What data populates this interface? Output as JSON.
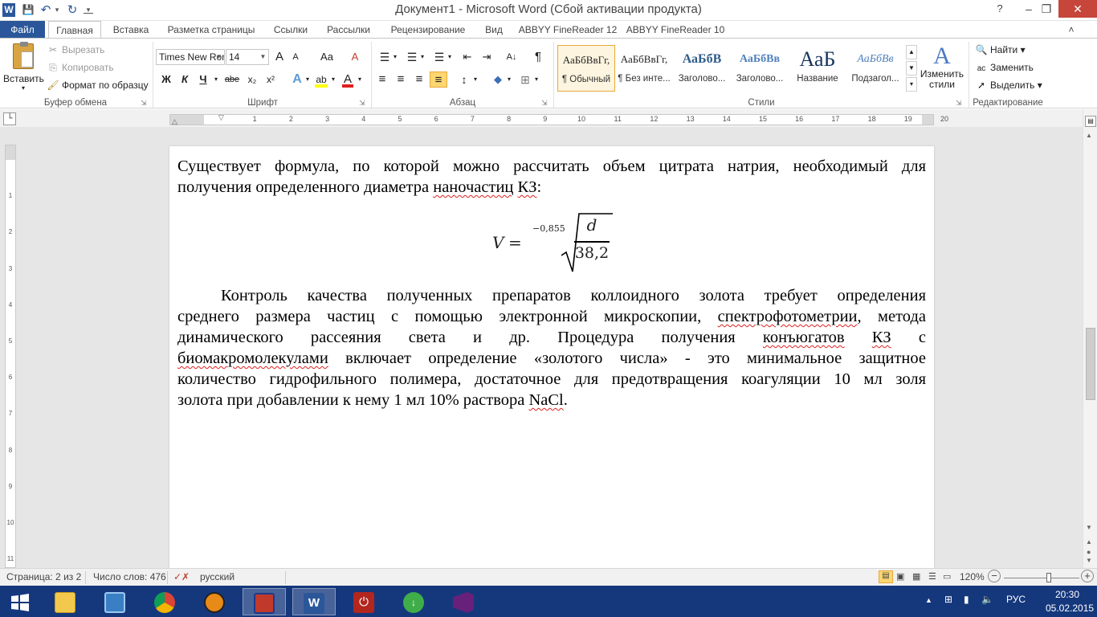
{
  "window": {
    "title": "Документ1 - Microsoft Word (Сбой активации продукта)",
    "help": "?",
    "minimize": "–",
    "restore": "❐",
    "close": "✕"
  },
  "quick_access": {
    "app_icon": "W",
    "save": "💾",
    "undo": "↶",
    "undo_arrow": "▾",
    "repeat": "↻",
    "customize": "▾"
  },
  "tabs": [
    "Файл",
    "Главная",
    "Вставка",
    "Разметка страницы",
    "Ссылки",
    "Рассылки",
    "Рецензирование",
    "Вид",
    "ABBYY FineReader 12",
    "ABBYY FineReader 10"
  ],
  "ribbon_collapse": "˄",
  "clipboard": {
    "group_label": "Буфер обмена",
    "paste": "Вставить",
    "cut": "Вырезать",
    "copy": "Копировать",
    "format_painter": "Формат по образцу"
  },
  "font": {
    "group_label": "Шрифт",
    "family": "Times New Roman",
    "size": "14",
    "grow": "A",
    "shrink": "A",
    "change_case": "Aa",
    "clear": "A",
    "bold": "Ж",
    "italic": "К",
    "underline": "Ч",
    "strike": "abe",
    "subscript": "x₂",
    "superscript": "x²",
    "text_effects": "A",
    "highlight": "ab",
    "font_color": "A",
    "highlight_color": "#ffff00",
    "font_color_value": "#e02020"
  },
  "paragraph": {
    "group_label": "Абзац",
    "bullets": "☰",
    "numbering": "☰",
    "multilevel": "☰",
    "decrease_indent": "⇤",
    "increase_indent": "⇥",
    "sort": "A↓",
    "show_marks": "¶",
    "align_left": "≡",
    "align_center": "≡",
    "align_right": "≡",
    "justify": "≡",
    "line_spacing": "↕",
    "shading": "◆",
    "borders": "⊞"
  },
  "styles": {
    "group_label": "Стили",
    "items": [
      {
        "preview": "АаБбВвГг,",
        "name": "¶ Обычный"
      },
      {
        "preview": "АаБбВвГг,",
        "name": "¶ Без инте..."
      },
      {
        "preview": "АаБбВ",
        "name": "Заголово..."
      },
      {
        "preview": "АаБбВв",
        "name": "Заголово..."
      },
      {
        "preview": "АаБ",
        "name": "Название"
      },
      {
        "preview": "АаБбВв",
        "name": "Подзагол..."
      }
    ],
    "change_styles": "Изменить стили"
  },
  "editing": {
    "group_label": "Редактирование",
    "find": "Найти",
    "replace": "Заменить",
    "select": "Выделить"
  },
  "ruler": {
    "h_ticks": [
      "1",
      "2",
      "3",
      "4",
      "5",
      "6",
      "7",
      "8",
      "9",
      "10",
      "11",
      "12",
      "13",
      "14",
      "15",
      "16",
      "17",
      "18",
      "19",
      "20"
    ],
    "v_ticks": [
      "1",
      "2",
      "3",
      "4",
      "5",
      "6",
      "7",
      "8",
      "9",
      "10",
      "11"
    ]
  },
  "document": {
    "para1_lines": [
      [
        {
          "t": "Существует формула, по которой можно рассчитать объем цитрата натрия, необходимый для",
          "err": false
        }
      ],
      [
        {
          "t": "получения определенного диаметра ",
          "err": false
        },
        {
          "t": "наночастиц",
          "err": true
        },
        {
          "t": " ",
          "err": false
        },
        {
          "t": "КЗ",
          "err": true
        },
        {
          "t": ":",
          "err": false
        }
      ]
    ],
    "formula": {
      "lhs": "V",
      "eq": "=",
      "exp": "−0,855",
      "num": "d",
      "den": "38,2"
    },
    "para2_lines": [
      [
        {
          "t": "Контроль качества полученных препаратов коллоидного золота требует определения",
          "err": false
        }
      ],
      [
        {
          "t": "среднего размера частиц с помощью электронной микроскопии, ",
          "err": false
        },
        {
          "t": "спектрофотометрии",
          "err": true
        },
        {
          "t": ", метода",
          "err": false
        }
      ],
      [
        {
          "t": "динамического рассеяния света и др. Процедура получения ",
          "err": false
        },
        {
          "t": "конъюгатов",
          "err": true
        },
        {
          "t": " ",
          "err": false
        },
        {
          "t": "КЗ",
          "err": true
        },
        {
          "t": " с",
          "err": false
        }
      ],
      [
        {
          "t": "биомакромолекулами",
          "err": true
        },
        {
          "t": " включает определение «золотого числа» - это минимальное защитное",
          "err": false
        }
      ],
      [
        {
          "t": "количество гидрофильного полимера, достаточное для предотвращения коагуляции 10 мл золя",
          "err": false
        }
      ],
      [
        {
          "t": "золота при добавлении к нему 1 мл 10% раствора ",
          "err": false
        },
        {
          "t": "NaCl",
          "err": true
        },
        {
          "t": ".",
          "err": false
        }
      ]
    ]
  },
  "status": {
    "page": "Страница: 2 из 2",
    "words": "Число слов: 476",
    "language": "русский",
    "zoom": "120%",
    "zoom_minus": "−",
    "zoom_plus": "+",
    "zoom_level": 0.6
  },
  "taskbar": {
    "apps": [
      "explorer",
      "control-panel",
      "chrome",
      "aimp",
      "flash-saver",
      "word",
      "power",
      "downloader",
      "visual-studio"
    ],
    "tray_up": "▲",
    "language": "РУС",
    "time": "20:30",
    "date": "05.02.2015"
  },
  "colors": {
    "accent": "#2b579a",
    "taskbar": "#15387d",
    "spellcheck": "#e02020"
  }
}
